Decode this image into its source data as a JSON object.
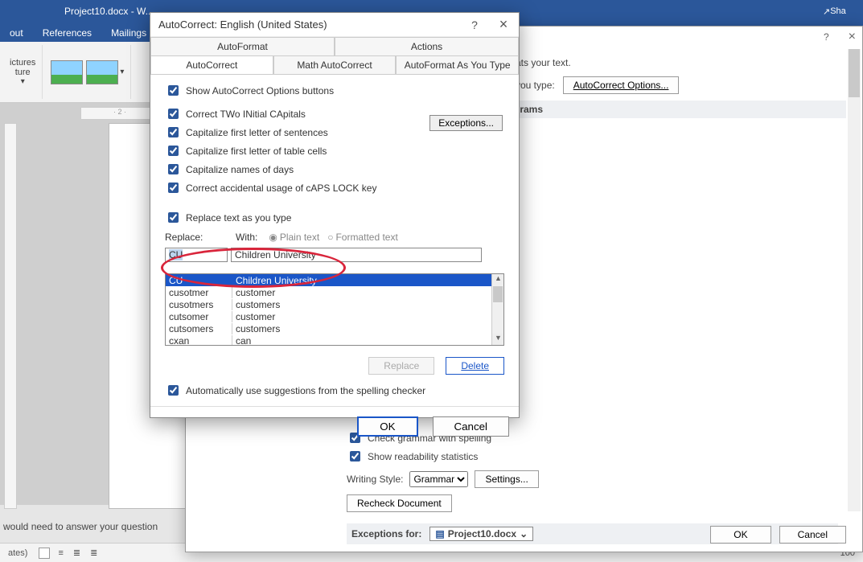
{
  "window": {
    "docname": "Project10.docx - W..."
  },
  "ribbon_tabs": [
    "out",
    "References",
    "Mailings"
  ],
  "ribbon_groups": {
    "pictures": "ictures",
    "picture": "ture"
  },
  "share": "Sha",
  "ruler_mark": "2",
  "bg_dialog": {
    "help": "?",
    "close": "×",
    "intro": "ats your text.",
    "ac_label": "you type:",
    "ac_button": "AutoCorrect Options...",
    "hdr_programs": "rograms",
    "chk_grammar": "Check grammar with spelling",
    "chk_readability": "Show readability statistics",
    "writing_style_lbl": "Writing Style:",
    "writing_style_val": "Grammar",
    "settings_btn": "Settings...",
    "recheck_btn": "Recheck Document",
    "exceptions_lbl": "Exceptions for:",
    "exceptions_val": "Project10.docx",
    "ok": "OK",
    "cancel": "Cancel",
    "zoom": "100"
  },
  "ac": {
    "title": "AutoCorrect: English (United States)",
    "help": "?",
    "close": "×",
    "tabs_row1": [
      "AutoFormat",
      "Actions"
    ],
    "tabs_row2": [
      "AutoCorrect",
      "Math AutoCorrect",
      "AutoFormat As You Type"
    ],
    "active_tab": "AutoCorrect",
    "chk_show": "Show AutoCorrect Options buttons",
    "chk_two": "Correct TWo INitial CApitals",
    "chk_sent": "Capitalize first letter of sentences",
    "chk_table": "Capitalize first letter of table cells",
    "chk_days": "Capitalize names of days",
    "chk_caps": "Correct accidental usage of cAPS LOCK key",
    "exceptions": "Exceptions...",
    "chk_replace": "Replace text as you type",
    "replace_lbl": "Replace:",
    "with_lbl": "With:",
    "radio_plain": "Plain text",
    "radio_fmt": "Formatted text",
    "replace_val": "CU",
    "with_val": "Children University",
    "list": [
      {
        "r": "CU",
        "w": "Children University",
        "sel": true
      },
      {
        "r": "cusotmer",
        "w": "customer"
      },
      {
        "r": "cusotmers",
        "w": "customers"
      },
      {
        "r": "cutsomer",
        "w": "customer"
      },
      {
        "r": "cutsomers",
        "w": "customers"
      },
      {
        "r": "cxan",
        "w": "can"
      }
    ],
    "btn_replace": "Replace",
    "btn_delete": "Delete",
    "chk_sugg": "Automatically use suggestions from the spelling checker",
    "ok": "OK",
    "cancel": "Cancel"
  },
  "status": {
    "left": "ates)",
    "question": "would need to answer your question"
  }
}
